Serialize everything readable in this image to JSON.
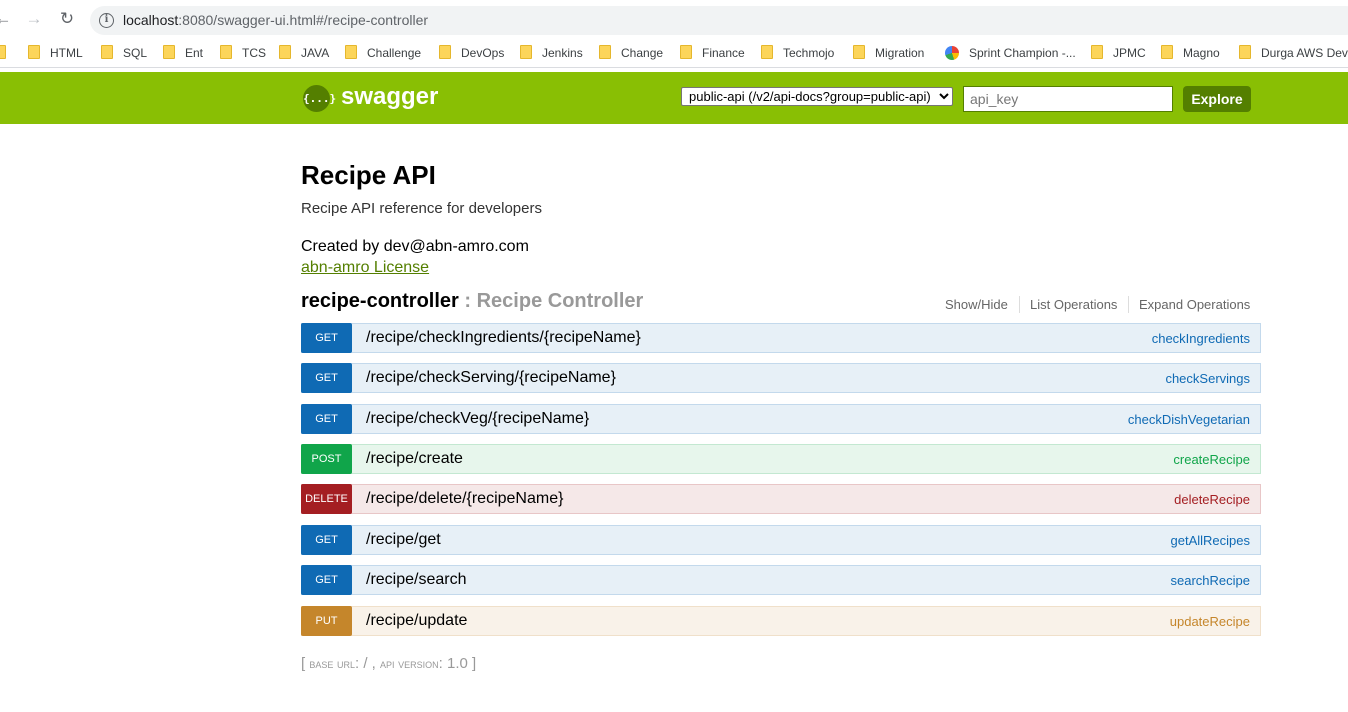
{
  "browser": {
    "url_host": "localhost",
    "url_rest": ":8080/swagger-ui.html#/recipe-controller",
    "bookmarks": [
      {
        "label": "HTML",
        "icon": "folder-icon"
      },
      {
        "label": "SQL",
        "icon": "folder-icon"
      },
      {
        "label": "Ent",
        "icon": "folder-icon"
      },
      {
        "label": "TCS",
        "icon": "folder-icon"
      },
      {
        "label": "JAVA",
        "icon": "folder-icon"
      },
      {
        "label": "Challenge",
        "icon": "folder-icon"
      },
      {
        "label": "DevOps",
        "icon": "folder-icon"
      },
      {
        "label": "Jenkins",
        "icon": "folder-icon"
      },
      {
        "label": "Change",
        "icon": "folder-icon"
      },
      {
        "label": "Finance",
        "icon": "folder-icon"
      },
      {
        "label": "Techmojo",
        "icon": "folder-icon"
      },
      {
        "label": "Migration",
        "icon": "folder-icon"
      },
      {
        "label": "Sprint Champion -...",
        "icon": "pie-chart-icon"
      },
      {
        "label": "JPMC",
        "icon": "folder-icon"
      },
      {
        "label": "Magno",
        "icon": "folder-icon"
      },
      {
        "label": "Durga AWS Devo",
        "icon": "folder-icon"
      }
    ]
  },
  "header": {
    "brand": "swagger",
    "logo_glyph": "{...}",
    "api_select_value": "public-api (/v2/api-docs?group=public-api)",
    "api_key_placeholder": "api_key",
    "explore_label": "Explore",
    "colors": {
      "bar": "#89bf04",
      "dark": "#547f00"
    }
  },
  "info": {
    "title": "Recipe API",
    "description": "Recipe API reference for developers",
    "created_by": "Created by dev@abn-amro.com",
    "license": "abn-amro License"
  },
  "controller": {
    "name": "recipe-controller",
    "description": ": Recipe Controller",
    "show_hide": "Show/Hide",
    "list_operations": "List Operations",
    "expand_operations": "Expand Operations",
    "operations": [
      {
        "method": "GET",
        "path": "/recipe/checkIngredients/{recipeName}",
        "nickname": "checkIngredients"
      },
      {
        "method": "GET",
        "path": "/recipe/checkServing/{recipeName}",
        "nickname": "checkServings"
      },
      {
        "method": "GET",
        "path": "/recipe/checkVeg/{recipeName}",
        "nickname": "checkDishVegetarian"
      },
      {
        "method": "POST",
        "path": "/recipe/create",
        "nickname": "createRecipe"
      },
      {
        "method": "DELETE",
        "path": "/recipe/delete/{recipeName}",
        "nickname": "deleteRecipe"
      },
      {
        "method": "GET",
        "path": "/recipe/get",
        "nickname": "getAllRecipes"
      },
      {
        "method": "GET",
        "path": "/recipe/search",
        "nickname": "searchRecipe"
      },
      {
        "method": "PUT",
        "path": "/recipe/update",
        "nickname": "updateRecipe"
      }
    ]
  },
  "footer": {
    "open": "[",
    "base_url_label": "base url",
    "base_url_value": ": / ,",
    "api_version_label": "api version",
    "api_version_value": ": 1.0",
    "close": "]"
  }
}
